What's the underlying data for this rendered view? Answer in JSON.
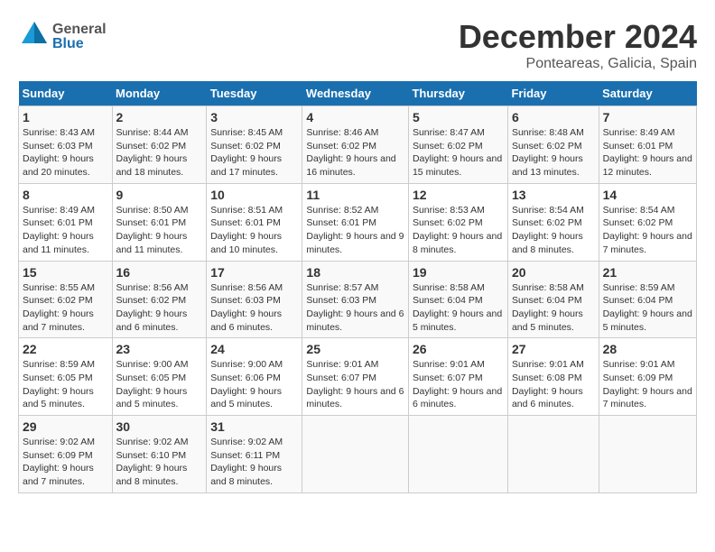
{
  "logo": {
    "general": "General",
    "blue": "Blue"
  },
  "title": "December 2024",
  "subtitle": "Ponteareas, Galicia, Spain",
  "days_header": [
    "Sunday",
    "Monday",
    "Tuesday",
    "Wednesday",
    "Thursday",
    "Friday",
    "Saturday"
  ],
  "weeks": [
    [
      {
        "day": "1",
        "sunrise": "Sunrise: 8:43 AM",
        "sunset": "Sunset: 6:03 PM",
        "daylight": "Daylight: 9 hours and 20 minutes."
      },
      {
        "day": "2",
        "sunrise": "Sunrise: 8:44 AM",
        "sunset": "Sunset: 6:02 PM",
        "daylight": "Daylight: 9 hours and 18 minutes."
      },
      {
        "day": "3",
        "sunrise": "Sunrise: 8:45 AM",
        "sunset": "Sunset: 6:02 PM",
        "daylight": "Daylight: 9 hours and 17 minutes."
      },
      {
        "day": "4",
        "sunrise": "Sunrise: 8:46 AM",
        "sunset": "Sunset: 6:02 PM",
        "daylight": "Daylight: 9 hours and 16 minutes."
      },
      {
        "day": "5",
        "sunrise": "Sunrise: 8:47 AM",
        "sunset": "Sunset: 6:02 PM",
        "daylight": "Daylight: 9 hours and 15 minutes."
      },
      {
        "day": "6",
        "sunrise": "Sunrise: 8:48 AM",
        "sunset": "Sunset: 6:02 PM",
        "daylight": "Daylight: 9 hours and 13 minutes."
      },
      {
        "day": "7",
        "sunrise": "Sunrise: 8:49 AM",
        "sunset": "Sunset: 6:01 PM",
        "daylight": "Daylight: 9 hours and 12 minutes."
      }
    ],
    [
      {
        "day": "8",
        "sunrise": "Sunrise: 8:49 AM",
        "sunset": "Sunset: 6:01 PM",
        "daylight": "Daylight: 9 hours and 11 minutes."
      },
      {
        "day": "9",
        "sunrise": "Sunrise: 8:50 AM",
        "sunset": "Sunset: 6:01 PM",
        "daylight": "Daylight: 9 hours and 11 minutes."
      },
      {
        "day": "10",
        "sunrise": "Sunrise: 8:51 AM",
        "sunset": "Sunset: 6:01 PM",
        "daylight": "Daylight: 9 hours and 10 minutes."
      },
      {
        "day": "11",
        "sunrise": "Sunrise: 8:52 AM",
        "sunset": "Sunset: 6:01 PM",
        "daylight": "Daylight: 9 hours and 9 minutes."
      },
      {
        "day": "12",
        "sunrise": "Sunrise: 8:53 AM",
        "sunset": "Sunset: 6:02 PM",
        "daylight": "Daylight: 9 hours and 8 minutes."
      },
      {
        "day": "13",
        "sunrise": "Sunrise: 8:54 AM",
        "sunset": "Sunset: 6:02 PM",
        "daylight": "Daylight: 9 hours and 8 minutes."
      },
      {
        "day": "14",
        "sunrise": "Sunrise: 8:54 AM",
        "sunset": "Sunset: 6:02 PM",
        "daylight": "Daylight: 9 hours and 7 minutes."
      }
    ],
    [
      {
        "day": "15",
        "sunrise": "Sunrise: 8:55 AM",
        "sunset": "Sunset: 6:02 PM",
        "daylight": "Daylight: 9 hours and 7 minutes."
      },
      {
        "day": "16",
        "sunrise": "Sunrise: 8:56 AM",
        "sunset": "Sunset: 6:02 PM",
        "daylight": "Daylight: 9 hours and 6 minutes."
      },
      {
        "day": "17",
        "sunrise": "Sunrise: 8:56 AM",
        "sunset": "Sunset: 6:03 PM",
        "daylight": "Daylight: 9 hours and 6 minutes."
      },
      {
        "day": "18",
        "sunrise": "Sunrise: 8:57 AM",
        "sunset": "Sunset: 6:03 PM",
        "daylight": "Daylight: 9 hours and 6 minutes."
      },
      {
        "day": "19",
        "sunrise": "Sunrise: 8:58 AM",
        "sunset": "Sunset: 6:04 PM",
        "daylight": "Daylight: 9 hours and 5 minutes."
      },
      {
        "day": "20",
        "sunrise": "Sunrise: 8:58 AM",
        "sunset": "Sunset: 6:04 PM",
        "daylight": "Daylight: 9 hours and 5 minutes."
      },
      {
        "day": "21",
        "sunrise": "Sunrise: 8:59 AM",
        "sunset": "Sunset: 6:04 PM",
        "daylight": "Daylight: 9 hours and 5 minutes."
      }
    ],
    [
      {
        "day": "22",
        "sunrise": "Sunrise: 8:59 AM",
        "sunset": "Sunset: 6:05 PM",
        "daylight": "Daylight: 9 hours and 5 minutes."
      },
      {
        "day": "23",
        "sunrise": "Sunrise: 9:00 AM",
        "sunset": "Sunset: 6:05 PM",
        "daylight": "Daylight: 9 hours and 5 minutes."
      },
      {
        "day": "24",
        "sunrise": "Sunrise: 9:00 AM",
        "sunset": "Sunset: 6:06 PM",
        "daylight": "Daylight: 9 hours and 5 minutes."
      },
      {
        "day": "25",
        "sunrise": "Sunrise: 9:01 AM",
        "sunset": "Sunset: 6:07 PM",
        "daylight": "Daylight: 9 hours and 6 minutes."
      },
      {
        "day": "26",
        "sunrise": "Sunrise: 9:01 AM",
        "sunset": "Sunset: 6:07 PM",
        "daylight": "Daylight: 9 hours and 6 minutes."
      },
      {
        "day": "27",
        "sunrise": "Sunrise: 9:01 AM",
        "sunset": "Sunset: 6:08 PM",
        "daylight": "Daylight: 9 hours and 6 minutes."
      },
      {
        "day": "28",
        "sunrise": "Sunrise: 9:01 AM",
        "sunset": "Sunset: 6:09 PM",
        "daylight": "Daylight: 9 hours and 7 minutes."
      }
    ],
    [
      {
        "day": "29",
        "sunrise": "Sunrise: 9:02 AM",
        "sunset": "Sunset: 6:09 PM",
        "daylight": "Daylight: 9 hours and 7 minutes."
      },
      {
        "day": "30",
        "sunrise": "Sunrise: 9:02 AM",
        "sunset": "Sunset: 6:10 PM",
        "daylight": "Daylight: 9 hours and 8 minutes."
      },
      {
        "day": "31",
        "sunrise": "Sunrise: 9:02 AM",
        "sunset": "Sunset: 6:11 PM",
        "daylight": "Daylight: 9 hours and 8 minutes."
      },
      null,
      null,
      null,
      null
    ]
  ]
}
